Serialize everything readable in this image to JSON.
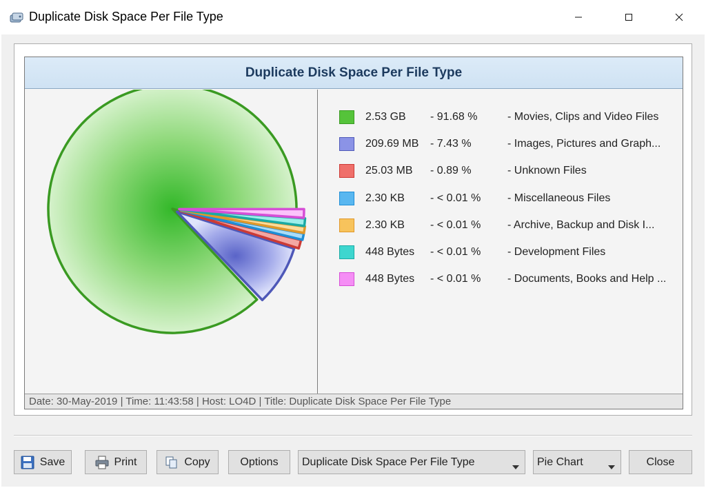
{
  "window": {
    "title": "Duplicate Disk Space Per File Type",
    "app_icon": "disk-scanner-icon",
    "controls": [
      "minimize-icon",
      "maximize-icon",
      "close-icon"
    ]
  },
  "report": {
    "title": "Duplicate Disk Space Per File Type",
    "status_line": "Date: 30-May-2019 | Time: 11:43:58 | Host: LO4D | Title: Duplicate Disk Space Per File Type"
  },
  "legend": [
    {
      "size": "2.53 GB",
      "percent": "- 91.68 %",
      "label": "- Movies, Clips and Video Files",
      "color": "#55c33a",
      "border": "#3a9a22"
    },
    {
      "size": "209.69 MB",
      "percent": "- 7.43 %",
      "label": "- Images, Pictures and Graph...",
      "color": "#8b93e6",
      "border": "#4e58b8"
    },
    {
      "size": "25.03 MB",
      "percent": "- 0.89 %",
      "label": "- Unknown Files",
      "color": "#ef6f6a",
      "border": "#cc3a35"
    },
    {
      "size": "2.30 KB",
      "percent": "- < 0.01 %",
      "label": "- Miscellaneous Files",
      "color": "#59b7f0",
      "border": "#1f8ed6"
    },
    {
      "size": "2.30 KB",
      "percent": "- < 0.01 %",
      "label": "- Archive, Backup and Disk I...",
      "color": "#f7c35c",
      "border": "#e0982a"
    },
    {
      "size": "448 Bytes",
      "percent": "- < 0.01 %",
      "label": "- Development Files",
      "color": "#3ed6cf",
      "border": "#1aaaa4"
    },
    {
      "size": "448 Bytes",
      "percent": "- < 0.01 %",
      "label": "- Documents, Books and Help ...",
      "color": "#f58ef5",
      "border": "#d64fd6"
    }
  ],
  "pie": {
    "main_fraction": 0.9168,
    "slices": [
      {
        "name": "Images, Pictures and Graph...",
        "fraction": 0.0743
      },
      {
        "name": "Unknown Files",
        "fraction": 0.0089
      },
      {
        "name": "Miscellaneous Files",
        "fraction": 0.0001
      },
      {
        "name": "Archive, Backup and Disk I...",
        "fraction": 0.0001
      },
      {
        "name": "Development Files",
        "fraction": 0.0001
      },
      {
        "name": "Documents, Books and Help ...",
        "fraction": 0.0001
      }
    ]
  },
  "toolbar": {
    "save_label": "Save",
    "print_label": "Print",
    "copy_label": "Copy",
    "options_label": "Options",
    "report_select_value": "Duplicate Disk Space Per File Type",
    "chart_type_value": "Pie Chart",
    "close_label": "Close"
  }
}
